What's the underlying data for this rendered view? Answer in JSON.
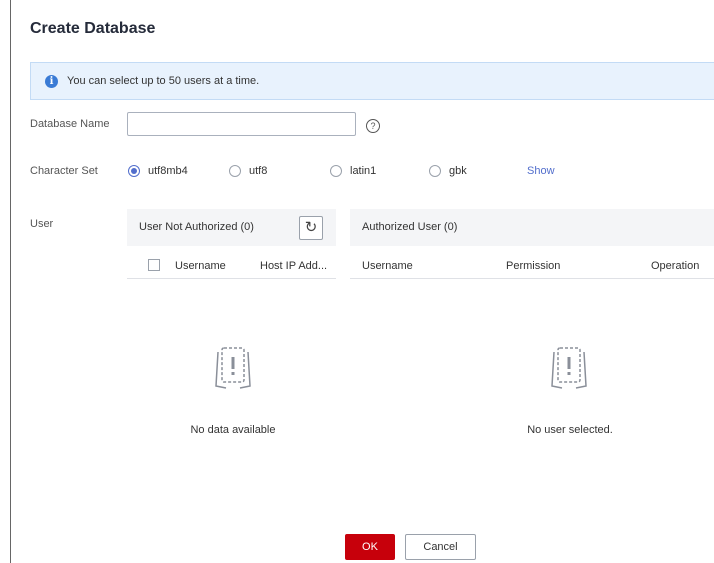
{
  "dialog": {
    "title": "Create Database"
  },
  "info": {
    "text": "You can select up to 50 users at a time.",
    "icon": "info-icon"
  },
  "form": {
    "database_name_label": "Database Name",
    "database_name_value": "",
    "character_set_label": "Character Set",
    "charsets": [
      {
        "label": "utf8mb4",
        "checked": true
      },
      {
        "label": "utf8",
        "checked": false
      },
      {
        "label": "latin1",
        "checked": false
      },
      {
        "label": "gbk",
        "checked": false
      }
    ],
    "show_link": "Show",
    "user_label": "User"
  },
  "unauthorized": {
    "title": "User Not Authorized (0)",
    "columns": [
      "Username",
      "Host IP Add..."
    ],
    "empty_text": "No data available"
  },
  "authorized": {
    "title": "Authorized User (0)",
    "columns": [
      "Username",
      "Permission",
      "Operation"
    ],
    "empty_text": "No user selected."
  },
  "footer": {
    "ok_label": "OK",
    "cancel_label": "Cancel"
  },
  "colors": {
    "accent": "#526ecc",
    "primary_button": "#c7000b",
    "info_bg": "#e8f2fd"
  }
}
